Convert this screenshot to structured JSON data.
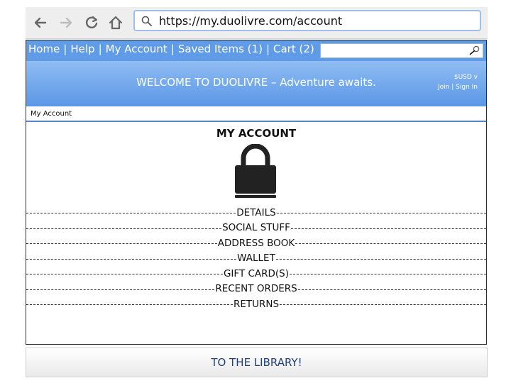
{
  "browser": {
    "url": "https://my.duolivre.com/account",
    "back_icon": "arrow-left-icon",
    "forward_icon": "arrow-right-icon",
    "reload_icon": "reload-icon",
    "home_icon": "home-icon",
    "search_icon": "search-icon"
  },
  "nav": {
    "links": [
      "Home",
      "Help",
      "My Account",
      "Saved Items (1)",
      "Cart (2)"
    ],
    "separator": "|",
    "search_icon": "search-icon"
  },
  "banner": {
    "welcome": "WELCOME TO DUOLIVRE – Adventure awaits.",
    "currency": "$USD v",
    "join": "Join",
    "auth_separator": "|",
    "sign_in": "Sign In"
  },
  "breadcrumb": "My Account",
  "main": {
    "title": "MY ACCOUNT",
    "lock_icon": "lock-icon",
    "menu": [
      "DETAILS",
      "SOCIAL STUFF",
      "ADDRESS BOOK",
      "WALLET",
      "GIFT CARD(S)",
      "RECENT ORDERS",
      "RETURNS"
    ]
  },
  "footer": {
    "button": "TO THE LIBRARY!"
  },
  "colors": {
    "nav_bar": "#5f9be6",
    "banner_top": "#8fbcf3",
    "banner_bottom": "#5b97e6",
    "footer_text": "#22407a"
  }
}
